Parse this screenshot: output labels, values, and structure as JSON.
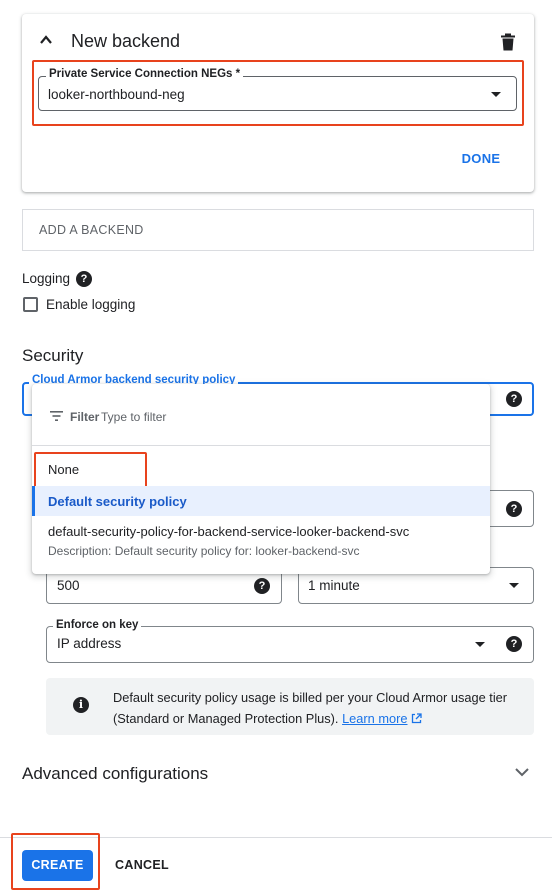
{
  "backend_card": {
    "title": "New backend",
    "neg_label": "Private Service Connection NEGs *",
    "neg_value": "looker-northbound-neg",
    "done_label": "DONE"
  },
  "add_backend_label": "ADD A BACKEND",
  "logging": {
    "label": "Logging",
    "checkbox_label": "Enable logging",
    "checked": false
  },
  "security": {
    "heading": "Security",
    "policy_label": "Cloud Armor backend security policy"
  },
  "dropdown": {
    "filter_label": "Filter",
    "filter_placeholder": "Type to filter",
    "options": [
      {
        "label": "None"
      },
      {
        "label": "Default security policy",
        "selected": true
      },
      {
        "label": "default-security-policy-for-backend-service-looker-backend-svc",
        "description": "Description: Default security policy for: looker-backend-svc"
      }
    ]
  },
  "rate_limit": {
    "count_value": "500",
    "interval_value": "1 minute"
  },
  "enforce_on_key": {
    "label": "Enforce on key",
    "value": "IP address"
  },
  "info": {
    "text": "Default security policy usage is billed per your Cloud Armor usage tier (Standard or Managed Protection Plus).",
    "link_text": "Learn more"
  },
  "advanced_label": "Advanced configurations",
  "footer": {
    "create_label": "CREATE",
    "cancel_label": "CANCEL"
  },
  "colors": {
    "accent": "#1a73e8",
    "highlight_border": "#e8431d",
    "selected_option_bg": "#e8f0fe"
  }
}
